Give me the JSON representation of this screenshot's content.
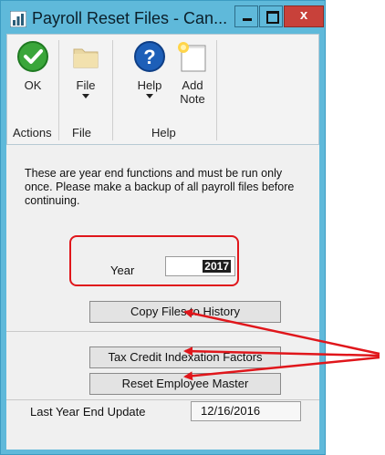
{
  "window": {
    "title": "Payroll Reset Files - Can...",
    "close_glyph": "x"
  },
  "ribbon": {
    "buttons": [
      {
        "label": "OK",
        "icon": "checkmark-icon"
      },
      {
        "label": "File",
        "icon": "folder-icon"
      },
      {
        "label": "Help",
        "icon": "help-icon"
      },
      {
        "label": "Add",
        "label2": "Note",
        "icon": "add-note-icon"
      }
    ],
    "groups": [
      "Actions",
      "File",
      "Help"
    ]
  },
  "content": {
    "info_text": "These are year end functions and must be run only once. Please make a backup of all payroll files before continuing.",
    "year_label": "Year",
    "year_value": "2017",
    "buttons": [
      "Copy Files to History",
      "Tax Credit Indexation Factors",
      "Reset Employee Master"
    ],
    "last_update_label": "Last Year End Update",
    "last_update_value": "12/16/2016"
  },
  "colors": {
    "titlebar": "#5fb9da",
    "close_button": "#c8413a",
    "annotation": "#e0161b",
    "ok_icon": "#3aa63a",
    "help_icon": "#1d5fb8"
  }
}
